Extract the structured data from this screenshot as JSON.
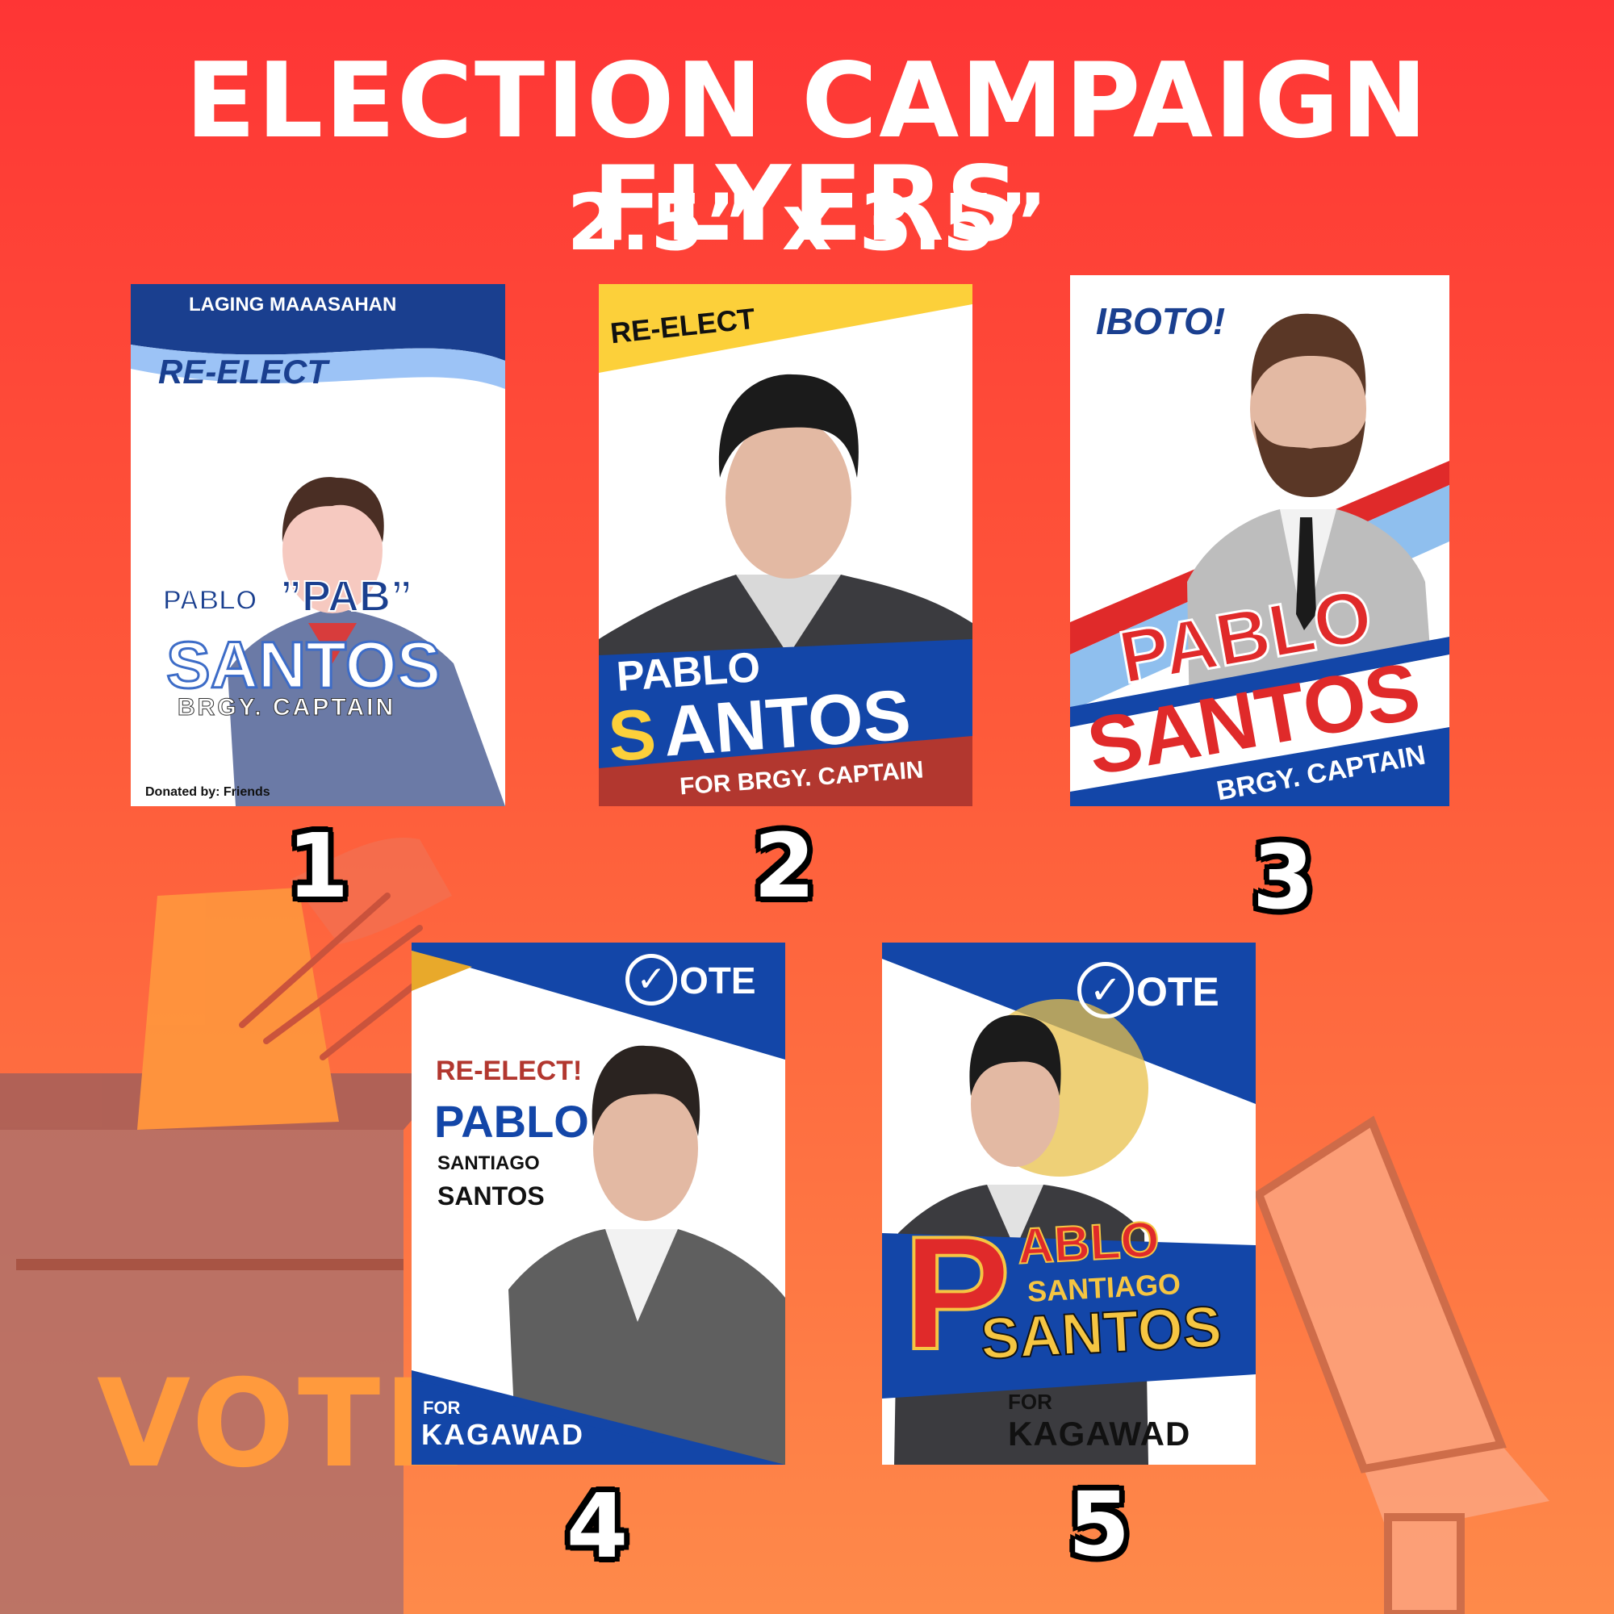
{
  "header": {
    "title": "ELECTION CAMPAIGN FLYERS",
    "subtitle": "2.5” x 3.5”"
  },
  "background": {
    "ballot_box_label": "VOTE",
    "colors": {
      "top": "#fe3535",
      "bottom": "#fe8a4a",
      "ballot_box": "#b0706a",
      "megaphone": "#fca27c"
    }
  },
  "flyers": [
    {
      "number": "1",
      "banner": "LAGING MAAASAHAN",
      "tagline": "RE-ELECT",
      "first_name": "PABLO",
      "nickname": "”PAB”",
      "last_name": "SANTOS",
      "position": "BRGY. CAPTAIN",
      "footer": "Donated by: Friends"
    },
    {
      "number": "2",
      "tagline": "RE-ELECT",
      "first_name": "PABLO",
      "last_name_initial": "S",
      "last_name_rest": "ANTOS",
      "position": "FOR BRGY. CAPTAIN"
    },
    {
      "number": "3",
      "tagline": "IBOTO!",
      "first_name": "PABLO",
      "last_name": "SANTOS",
      "position": "BRGY. CAPTAIN"
    },
    {
      "number": "4",
      "vote_label": "OTE",
      "tagline": "RE-ELECT!",
      "first_name": "PABLO",
      "middle_name": "SANTIAGO",
      "last_name": "SANTOS",
      "position_prefix": "FOR",
      "position": "KAGAWAD"
    },
    {
      "number": "5",
      "vote_label": "OTE",
      "first_initial": "P",
      "first_name_rest": "ABLO",
      "middle_name": "SANTIAGO",
      "last_name": "SANTOS",
      "position_prefix": "FOR",
      "position": "KAGAWAD"
    }
  ]
}
